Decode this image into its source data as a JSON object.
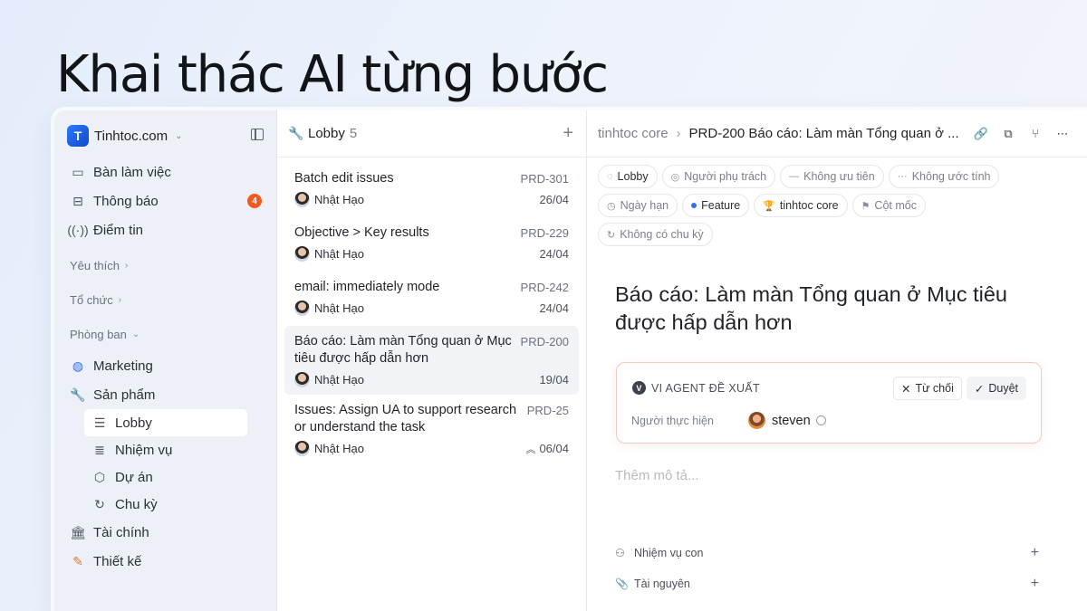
{
  "headline": "Khai thác AI từng bước",
  "sidebar": {
    "workspace": "Tinhtoc.com",
    "items": [
      {
        "label": "Bàn làm việc",
        "icon": "inbox-tray-icon"
      },
      {
        "label": "Thông báo",
        "icon": "inbox-icon",
        "badge": "4"
      },
      {
        "label": "Điểm tin",
        "icon": "broadcast-icon"
      }
    ],
    "favorites": "Yêu thích",
    "organization": "Tổ chức",
    "teams": "Phòng ban",
    "team_items": [
      {
        "label": "Marketing",
        "icon": "globe-icon"
      },
      {
        "label": "Sản phẩm",
        "icon": "wrench-icon"
      }
    ],
    "product_sub": [
      {
        "label": "Lobby",
        "icon": "list-icon"
      },
      {
        "label": "Nhiệm vụ",
        "icon": "stack-icon"
      },
      {
        "label": "Dự án",
        "icon": "cube-icon"
      },
      {
        "label": "Chu kỳ",
        "icon": "cycle-icon"
      }
    ],
    "bottom_items": [
      {
        "label": "Tài chính",
        "icon": "bank-icon"
      },
      {
        "label": "Thiết kế",
        "icon": "design-tools-icon"
      }
    ]
  },
  "list": {
    "title": "Lobby",
    "count": "5",
    "issues": [
      {
        "title": "Batch edit issues",
        "id": "PRD-301",
        "assignee": "Nhật Hạo",
        "date": "26/04"
      },
      {
        "title": "Objective > Key results",
        "id": "PRD-229",
        "assignee": "Nhật Hạo",
        "date": "24/04"
      },
      {
        "title": "email: immediately mode",
        "id": "PRD-242",
        "assignee": "Nhật Hạo",
        "date": "24/04"
      },
      {
        "title": "Báo cáo: Làm màn Tổng quan ở Mục tiêu được hấp dẫn hơn",
        "id": "PRD-200",
        "assignee": "Nhật Hạo",
        "date": "19/04"
      },
      {
        "title": "Issues: Assign UA to support research or understand the task",
        "id": "PRD-25",
        "assignee": "Nhật Hạo",
        "date": "06/04"
      }
    ]
  },
  "detail": {
    "crumb_parent": "tinhtoc core",
    "crumb_current": "PRD-200 Báo cáo: Làm màn Tổng quan ở ...",
    "props": {
      "status": "Lobby",
      "assignee": "Người phụ trách",
      "priority": "Không ưu tiên",
      "estimate": "Không ước tính",
      "due": "Ngày hạn",
      "label": "Feature",
      "project": "tinhtoc core",
      "milestone": "Cột mốc",
      "cycle": "Không có chu kỳ"
    },
    "title": "Báo cáo: Làm màn Tổng quan ở Mục tiêu được hấp dẫn hơn",
    "agent": {
      "heading": "VI AGENT ĐỀ XUẤT",
      "reject": "Từ chối",
      "approve": "Duyệt",
      "field": "Người thực hiện",
      "value": "steven"
    },
    "description_placeholder": "Thêm mô tả...",
    "subtasks": "Nhiệm vụ con",
    "resources": "Tài nguyên"
  },
  "colors": {
    "accent": "#2f6fed",
    "badge": "#f35a1f",
    "agent_border": "#f6c9bb"
  }
}
